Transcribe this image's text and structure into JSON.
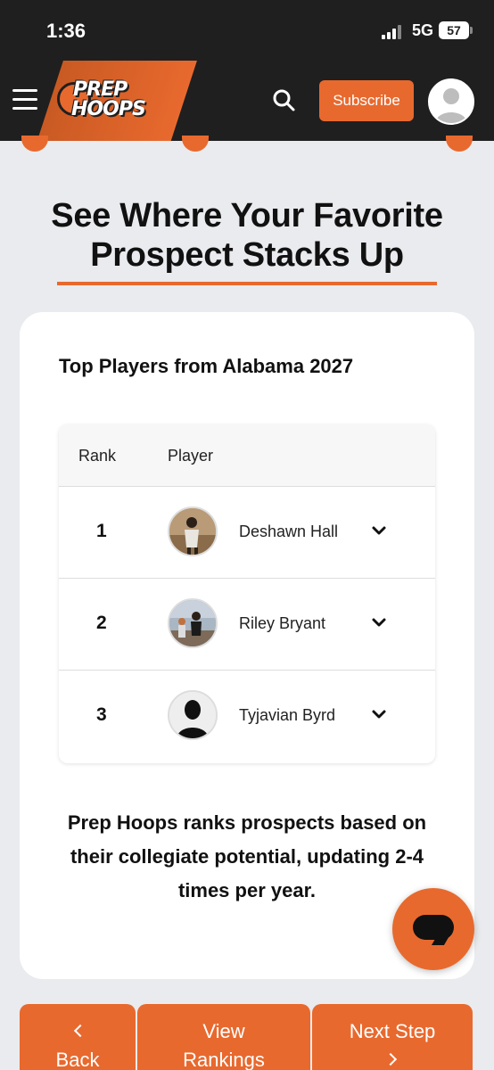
{
  "status_bar": {
    "time": "1:36",
    "network": "5G",
    "battery": "57"
  },
  "header": {
    "logo_line1": "PREP",
    "logo_line2": "HOOPS",
    "subscribe_label": "Subscribe",
    "icons": [
      "menu-icon",
      "search-icon",
      "avatar-icon"
    ]
  },
  "heading": {
    "line1": "See Where Your Favorite",
    "line2": "Prospect Stacks Up"
  },
  "card": {
    "title": "Top Players from Alabama 2027",
    "columns": [
      "Rank",
      "Player"
    ],
    "rows": [
      {
        "rank": "1",
        "name": "Deshawn Hall"
      },
      {
        "rank": "2",
        "name": "Riley Bryant"
      },
      {
        "rank": "3",
        "name": "Tyjavian Byrd"
      }
    ],
    "description": "Prep Hoops ranks prospects based on their collegiate potential, updating 2-4 times per year."
  },
  "bottom_nav": {
    "back_label": "Back",
    "rankings_line1": "View",
    "rankings_line2": "Rankings",
    "next_label": "Next Step"
  },
  "colors": {
    "accent": "#e8692e",
    "header_bg": "#1f1f1f",
    "page_bg": "#e9ebee"
  }
}
